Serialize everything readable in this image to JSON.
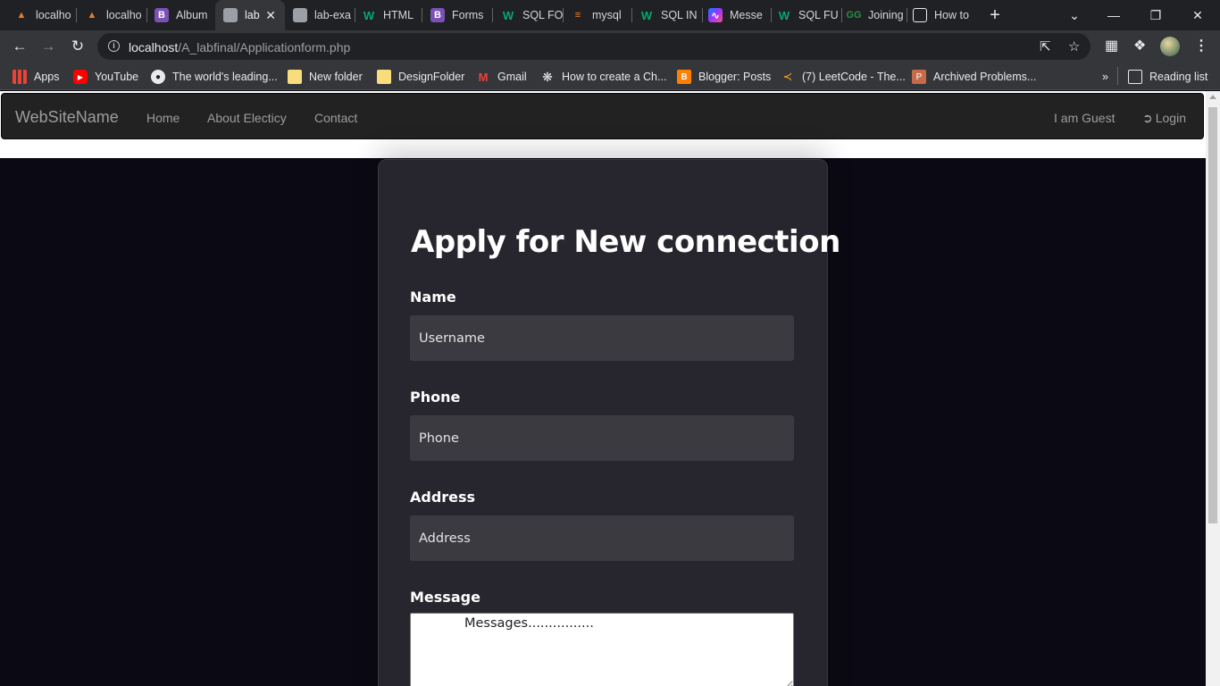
{
  "browser": {
    "tabs": [
      {
        "title": "localho",
        "favicon": "xampp-icon"
      },
      {
        "title": "localho",
        "favicon": "xampp-icon"
      },
      {
        "title": "Album",
        "favicon": "bootstrap-icon"
      },
      {
        "title": "lab",
        "favicon": "globe-icon",
        "active": true
      },
      {
        "title": "lab-exa",
        "favicon": "globe-icon"
      },
      {
        "title": "HTML",
        "favicon": "w3schools-icon"
      },
      {
        "title": "Forms",
        "favicon": "bootstrap-icon"
      },
      {
        "title": "SQL FO",
        "favicon": "w3schools-icon"
      },
      {
        "title": "mysql",
        "favicon": "stackoverflow-icon"
      },
      {
        "title": "SQL IN",
        "favicon": "w3schools-icon"
      },
      {
        "title": "Messe",
        "favicon": "messenger-icon"
      },
      {
        "title": "SQL FU",
        "favicon": "w3schools-icon"
      },
      {
        "title": "Joining",
        "favicon": "geeksforgeeks-icon"
      },
      {
        "title": "How to",
        "favicon": "doc-icon"
      }
    ],
    "url_host": "localhost",
    "url_path": "/A_labfinal/Applicationform.php",
    "bookmarks": [
      {
        "label": "Apps",
        "icon": "apps-icon"
      },
      {
        "label": "YouTube",
        "icon": "youtube-icon"
      },
      {
        "label": "The world's leading...",
        "icon": "github-icon"
      },
      {
        "label": "New folder",
        "icon": "folder-icon"
      },
      {
        "label": "DesignFolder",
        "icon": "folder-icon"
      },
      {
        "label": "Gmail",
        "icon": "gmail-icon"
      },
      {
        "label": "How to create a Ch...",
        "icon": "codegrepper-icon"
      },
      {
        "label": "Blogger: Posts",
        "icon": "blogger-icon"
      },
      {
        "label": "(7) LeetCode - The...",
        "icon": "leetcode-icon"
      },
      {
        "label": "Archived Problems...",
        "icon": "archive-icon"
      }
    ],
    "bookmarks_overflow": "»",
    "reading_list": "Reading list"
  },
  "navbar": {
    "brand": "WebSiteName",
    "links": [
      "Home",
      "About Electicy",
      "Contact"
    ],
    "guest": "I am Guest",
    "login": "Login"
  },
  "form": {
    "title": "Apply for New connection",
    "name_label": "Name",
    "name_placeholder": "Username",
    "phone_label": "Phone",
    "phone_placeholder": "Phone",
    "address_label": "Address",
    "address_placeholder": "Address",
    "message_label": "Message",
    "message_placeholder": "Messages................"
  }
}
